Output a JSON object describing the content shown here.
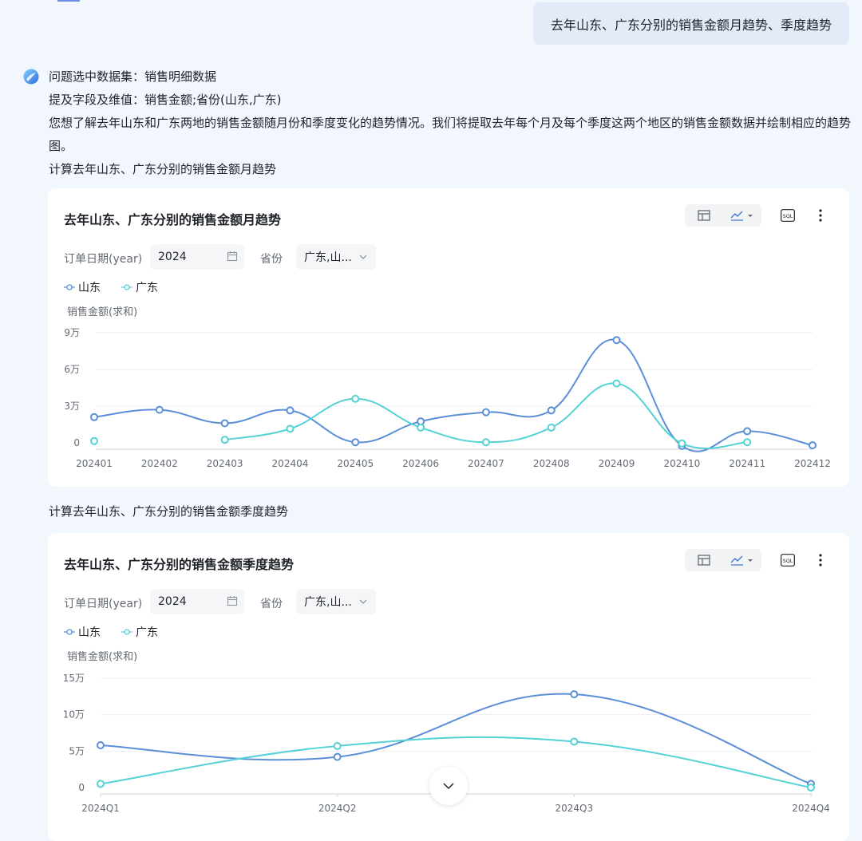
{
  "user_query": "去年山东、广东分别的销售金额月趋势、季度趋势",
  "answer": {
    "dataset_line": "问题选中数据集：销售明细数据",
    "fields_line": "提及字段及维值：销售金额;省份(山东,广东)",
    "explanation": "您想了解去年山东和广东两地的销售金额随月份和季度变化的趋势情况。我们将提取去年每个月及每个季度这两个地区的销售金额数据并绘制相应的趋势图。",
    "step_monthly": "计算去年山东、广东分别的销售金额月趋势",
    "step_quarterly": "计算去年山东、广东分别的销售金额季度趋势"
  },
  "filters": {
    "date_label": "订单日期(year)",
    "date_value": "2024",
    "province_label": "省份",
    "province_value": "广东,山..."
  },
  "toolbar": {
    "table_icon": "table-icon",
    "line_icon": "line-chart-icon",
    "sql_icon": "sql-icon",
    "more_icon": "more-vertical-icon"
  },
  "colors": {
    "shandong": "#5b8fd8",
    "guangdong": "#54d2d6"
  },
  "chart_data": [
    {
      "type": "line",
      "title": "去年山东、广东分别的销售金额月趋势",
      "ylabel": "销售金额(求和)",
      "xlabel": "",
      "categories": [
        "202401",
        "202402",
        "202403",
        "202404",
        "202405",
        "202406",
        "202407",
        "202408",
        "202409",
        "202410",
        "202411",
        "202412"
      ],
      "series": [
        {
          "name": "山东",
          "values": [
            21000,
            27000,
            16000,
            26500,
            500,
            17500,
            25000,
            26500,
            84000,
            -2500,
            9500,
            -2000
          ]
        },
        {
          "name": "广东",
          "values": [
            1500,
            null,
            2500,
            11500,
            36000,
            12500,
            500,
            12500,
            48500,
            -500,
            500,
            null
          ]
        }
      ],
      "yticks": [
        0,
        30000,
        60000,
        90000
      ],
      "ytick_labels": [
        "0",
        "3万",
        "6万",
        "9万"
      ],
      "ylim": [
        -5000,
        90000
      ],
      "grid": true,
      "legend": "top-left"
    },
    {
      "type": "line",
      "title": "去年山东、广东分别的销售金额季度趋势",
      "ylabel": "销售金额(求和)",
      "xlabel": "",
      "categories": [
        "2024Q1",
        "2024Q2",
        "2024Q3",
        "2024Q4"
      ],
      "series": [
        {
          "name": "山东",
          "values": [
            58000,
            42000,
            128000,
            5000
          ]
        },
        {
          "name": "广东",
          "values": [
            5000,
            57000,
            63000,
            0
          ]
        }
      ],
      "yticks": [
        0,
        50000,
        100000,
        150000
      ],
      "ytick_labels": [
        "0",
        "5万",
        "10万",
        "15万"
      ],
      "ylim": [
        -6000,
        150000
      ],
      "grid": true,
      "legend": "top-left"
    }
  ]
}
